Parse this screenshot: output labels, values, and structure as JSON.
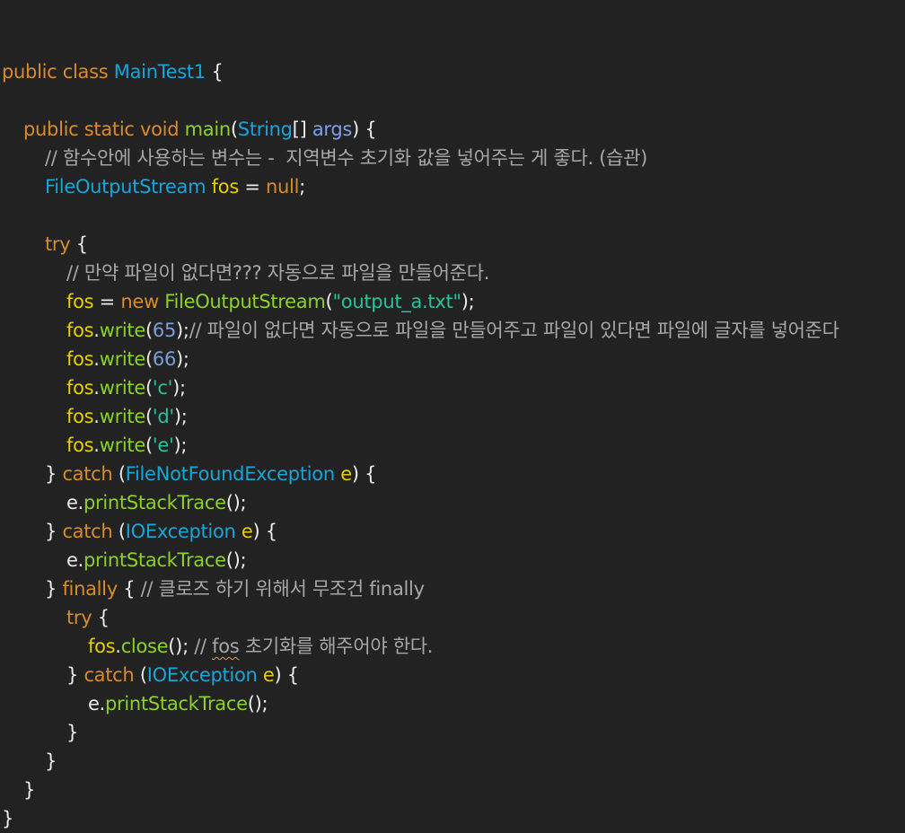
{
  "code": {
    "lines": [
      {
        "indent": 0,
        "tokens": []
      },
      {
        "indent": 0,
        "tokens": [
          {
            "t": "public class ",
            "c": "kw"
          },
          {
            "t": "MainTest1",
            "c": "cls"
          },
          {
            "t": " {",
            "c": "pn"
          }
        ]
      },
      {
        "indent": 0,
        "tokens": []
      },
      {
        "indent": 1,
        "tokens": [
          {
            "t": "public static void ",
            "c": "kw"
          },
          {
            "t": "main",
            "c": "fn"
          },
          {
            "t": "(",
            "c": "pn"
          },
          {
            "t": "String",
            "c": "ty"
          },
          {
            "t": "[] ",
            "c": "pn"
          },
          {
            "t": "args",
            "c": "prm"
          },
          {
            "t": ") {",
            "c": "pn"
          }
        ]
      },
      {
        "indent": 2,
        "tokens": [
          {
            "t": "// 함수안에 사용하는 변수는 -  지역변수 초기화 값을 넣어주는 게 좋다. (습관)",
            "c": "cmt"
          }
        ]
      },
      {
        "indent": 2,
        "tokens": [
          {
            "t": "FileOutputStream",
            "c": "ty"
          },
          {
            "t": " ",
            "c": "pn"
          },
          {
            "t": "fos",
            "c": "var"
          },
          {
            "t": " = ",
            "c": "pn"
          },
          {
            "t": "null",
            "c": "kw"
          },
          {
            "t": ";",
            "c": "pn"
          }
        ]
      },
      {
        "indent": 0,
        "tokens": []
      },
      {
        "indent": 2,
        "tokens": [
          {
            "t": "try",
            "c": "kw"
          },
          {
            "t": " {",
            "c": "pn"
          }
        ]
      },
      {
        "indent": 3,
        "tokens": [
          {
            "t": "// 만약 파일이 없다면??? 자동으로 파일을 만들어준다.",
            "c": "cmt"
          }
        ]
      },
      {
        "indent": 3,
        "tokens": [
          {
            "t": "fos",
            "c": "var"
          },
          {
            "t": " = ",
            "c": "pn"
          },
          {
            "t": "new",
            "c": "kw"
          },
          {
            "t": " ",
            "c": "pn"
          },
          {
            "t": "FileOutputStream",
            "c": "fn"
          },
          {
            "t": "(",
            "c": "pn"
          },
          {
            "t": "\"output_a.txt\"",
            "c": "str"
          },
          {
            "t": ");",
            "c": "pn"
          }
        ]
      },
      {
        "indent": 3,
        "tokens": [
          {
            "t": "fos",
            "c": "var"
          },
          {
            "t": ".",
            "c": "pn"
          },
          {
            "t": "write",
            "c": "fn"
          },
          {
            "t": "(",
            "c": "pn"
          },
          {
            "t": "65",
            "c": "num"
          },
          {
            "t": ");",
            "c": "pn"
          },
          {
            "t": "// 파일이 없다면 자동으로 파일을 만들어주고 파일이 있다면 파일에 글자를 넣어준다",
            "c": "cmt"
          }
        ]
      },
      {
        "indent": 3,
        "tokens": [
          {
            "t": "fos",
            "c": "var"
          },
          {
            "t": ".",
            "c": "pn"
          },
          {
            "t": "write",
            "c": "fn"
          },
          {
            "t": "(",
            "c": "pn"
          },
          {
            "t": "66",
            "c": "num"
          },
          {
            "t": ");",
            "c": "pn"
          }
        ]
      },
      {
        "indent": 3,
        "tokens": [
          {
            "t": "fos",
            "c": "var"
          },
          {
            "t": ".",
            "c": "pn"
          },
          {
            "t": "write",
            "c": "fn"
          },
          {
            "t": "(",
            "c": "pn"
          },
          {
            "t": "'c'",
            "c": "str"
          },
          {
            "t": ");",
            "c": "pn"
          }
        ]
      },
      {
        "indent": 3,
        "tokens": [
          {
            "t": "fos",
            "c": "var"
          },
          {
            "t": ".",
            "c": "pn"
          },
          {
            "t": "write",
            "c": "fn"
          },
          {
            "t": "(",
            "c": "pn"
          },
          {
            "t": "'d'",
            "c": "str"
          },
          {
            "t": ");",
            "c": "pn"
          }
        ]
      },
      {
        "indent": 3,
        "tokens": [
          {
            "t": "fos",
            "c": "var"
          },
          {
            "t": ".",
            "c": "pn"
          },
          {
            "t": "write",
            "c": "fn"
          },
          {
            "t": "(",
            "c": "pn"
          },
          {
            "t": "'e'",
            "c": "str"
          },
          {
            "t": ");",
            "c": "pn"
          }
        ]
      },
      {
        "indent": 2,
        "tokens": [
          {
            "t": "} ",
            "c": "pn"
          },
          {
            "t": "catch",
            "c": "kw"
          },
          {
            "t": " (",
            "c": "pn"
          },
          {
            "t": "FileNotFoundException",
            "c": "ty"
          },
          {
            "t": " ",
            "c": "pn"
          },
          {
            "t": "e",
            "c": "var"
          },
          {
            "t": ") {",
            "c": "pn"
          }
        ]
      },
      {
        "indent": 3,
        "tokens": [
          {
            "t": "e",
            "c": "pn"
          },
          {
            "t": ".",
            "c": "pn"
          },
          {
            "t": "printStackTrace",
            "c": "fn"
          },
          {
            "t": "();",
            "c": "pn"
          }
        ]
      },
      {
        "indent": 2,
        "tokens": [
          {
            "t": "} ",
            "c": "pn"
          },
          {
            "t": "catch",
            "c": "kw"
          },
          {
            "t": " (",
            "c": "pn"
          },
          {
            "t": "IOException",
            "c": "ty"
          },
          {
            "t": " ",
            "c": "pn"
          },
          {
            "t": "e",
            "c": "var"
          },
          {
            "t": ") {",
            "c": "pn"
          }
        ]
      },
      {
        "indent": 3,
        "tokens": [
          {
            "t": "e",
            "c": "pn"
          },
          {
            "t": ".",
            "c": "pn"
          },
          {
            "t": "printStackTrace",
            "c": "fn"
          },
          {
            "t": "();",
            "c": "pn"
          }
        ]
      },
      {
        "indent": 2,
        "tokens": [
          {
            "t": "} ",
            "c": "pn"
          },
          {
            "t": "finally",
            "c": "kw"
          },
          {
            "t": " { ",
            "c": "pn"
          },
          {
            "t": "// 클로즈 하기 위해서 무조건 finally",
            "c": "cmt"
          }
        ]
      },
      {
        "indent": 3,
        "tokens": [
          {
            "t": "try",
            "c": "kw"
          },
          {
            "t": " {",
            "c": "pn"
          }
        ]
      },
      {
        "indent": 4,
        "tokens": [
          {
            "t": "fos",
            "c": "var"
          },
          {
            "t": ".",
            "c": "pn"
          },
          {
            "t": "close",
            "c": "fn"
          },
          {
            "t": "(); ",
            "c": "pn"
          },
          {
            "t": "// ",
            "c": "cmt"
          },
          {
            "t": "fos",
            "c": "cmt sq"
          },
          {
            "t": " 초기화를 해주어야 한다.",
            "c": "cmt"
          }
        ]
      },
      {
        "indent": 3,
        "tokens": [
          {
            "t": "} ",
            "c": "pn"
          },
          {
            "t": "catch",
            "c": "kw"
          },
          {
            "t": " (",
            "c": "pn"
          },
          {
            "t": "IOException",
            "c": "ty"
          },
          {
            "t": " ",
            "c": "pn"
          },
          {
            "t": "e",
            "c": "var"
          },
          {
            "t": ") {",
            "c": "pn"
          }
        ]
      },
      {
        "indent": 4,
        "tokens": [
          {
            "t": "e",
            "c": "pn"
          },
          {
            "t": ".",
            "c": "pn"
          },
          {
            "t": "printStackTrace",
            "c": "fn"
          },
          {
            "t": "();",
            "c": "pn"
          }
        ]
      },
      {
        "indent": 3,
        "tokens": [
          {
            "t": "}",
            "c": "pn"
          }
        ]
      },
      {
        "indent": 2,
        "tokens": [
          {
            "t": "}",
            "c": "pn"
          }
        ]
      },
      {
        "indent": 1,
        "tokens": [
          {
            "t": "}",
            "c": "pn"
          }
        ]
      },
      {
        "indent": 0,
        "tokens": [
          {
            "t": "}",
            "c": "pn"
          }
        ]
      }
    ]
  }
}
